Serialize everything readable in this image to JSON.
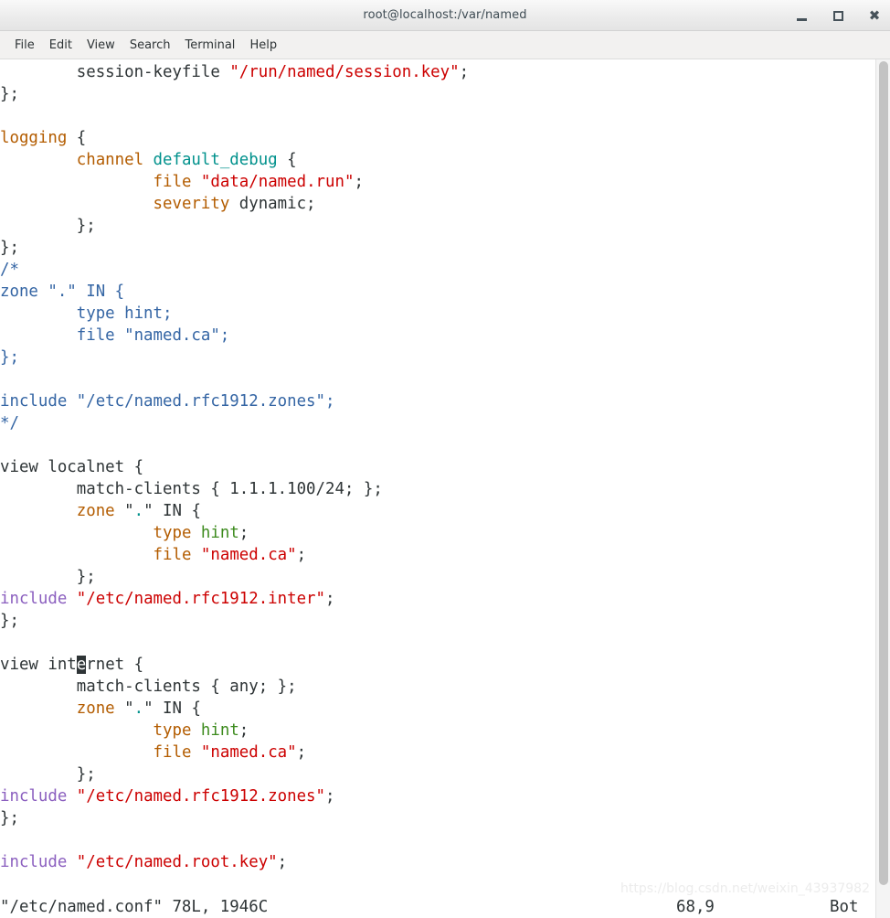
{
  "window": {
    "title": "root@localhost:/var/named",
    "buttons": {
      "minimize": "minimize-button",
      "maximize": "maximize-button",
      "close": "close-button"
    }
  },
  "menubar": {
    "items": [
      {
        "label": "File"
      },
      {
        "label": "Edit"
      },
      {
        "label": "View"
      },
      {
        "label": "Search"
      },
      {
        "label": "Terminal"
      },
      {
        "label": "Help"
      }
    ]
  },
  "editor": {
    "program": "vim",
    "colors": {
      "plain": "#2e3436",
      "keyword": "#b35c00",
      "identifier": "#00918c",
      "string": "#cc0000",
      "comment": "#3465a4",
      "preproc": "#8b5fbf",
      "type": "#3d8b1e",
      "cursor_bg": "#2e3436",
      "background": "#ffffff"
    },
    "lines": [
      [
        {
          "t": "        ",
          "c": "plain"
        },
        {
          "t": "session-keyfile",
          "c": "plain"
        },
        {
          "t": " ",
          "c": "plain"
        },
        {
          "t": "\"/run/named/session.key\"",
          "c": "string"
        },
        {
          "t": ";",
          "c": "plain"
        }
      ],
      [
        {
          "t": "};",
          "c": "plain"
        }
      ],
      [],
      [
        {
          "t": "logging",
          "c": "keyword"
        },
        {
          "t": " {",
          "c": "plain"
        }
      ],
      [
        {
          "t": "        ",
          "c": "plain"
        },
        {
          "t": "channel",
          "c": "keyword"
        },
        {
          "t": " ",
          "c": "plain"
        },
        {
          "t": "default_debug",
          "c": "identifier"
        },
        {
          "t": " {",
          "c": "plain"
        }
      ],
      [
        {
          "t": "                ",
          "c": "plain"
        },
        {
          "t": "file",
          "c": "keyword"
        },
        {
          "t": " ",
          "c": "plain"
        },
        {
          "t": "\"data/named.run\"",
          "c": "string"
        },
        {
          "t": ";",
          "c": "plain"
        }
      ],
      [
        {
          "t": "                ",
          "c": "plain"
        },
        {
          "t": "severity",
          "c": "keyword"
        },
        {
          "t": " dynamic;",
          "c": "plain"
        }
      ],
      [
        {
          "t": "        };",
          "c": "plain"
        }
      ],
      [
        {
          "t": "};",
          "c": "plain"
        }
      ],
      [
        {
          "t": "/*",
          "c": "comment"
        }
      ],
      [
        {
          "t": "zone \".\" IN {",
          "c": "comment"
        }
      ],
      [
        {
          "t": "        type hint;",
          "c": "comment"
        }
      ],
      [
        {
          "t": "        file \"named.ca\";",
          "c": "comment"
        }
      ],
      [
        {
          "t": "};",
          "c": "comment"
        }
      ],
      [],
      [
        {
          "t": "include \"/etc/named.rfc1912.zones\";",
          "c": "comment"
        }
      ],
      [
        {
          "t": "*/",
          "c": "comment"
        }
      ],
      [],
      [
        {
          "t": "view localnet {",
          "c": "plain"
        }
      ],
      [
        {
          "t": "        match-clients { 1.1.1.100/24; };",
          "c": "plain"
        }
      ],
      [
        {
          "t": "        ",
          "c": "plain"
        },
        {
          "t": "zone",
          "c": "keyword"
        },
        {
          "t": " \"",
          "c": "plain"
        },
        {
          "t": ".",
          "c": "identifier"
        },
        {
          "t": "\" IN {",
          "c": "plain"
        }
      ],
      [
        {
          "t": "                ",
          "c": "plain"
        },
        {
          "t": "type",
          "c": "keyword"
        },
        {
          "t": " ",
          "c": "plain"
        },
        {
          "t": "hint",
          "c": "type"
        },
        {
          "t": ";",
          "c": "plain"
        }
      ],
      [
        {
          "t": "                ",
          "c": "plain"
        },
        {
          "t": "file",
          "c": "keyword"
        },
        {
          "t": " ",
          "c": "plain"
        },
        {
          "t": "\"named.ca\"",
          "c": "string"
        },
        {
          "t": ";",
          "c": "plain"
        }
      ],
      [
        {
          "t": "        };",
          "c": "plain"
        }
      ],
      [
        {
          "t": "include",
          "c": "preproc"
        },
        {
          "t": " ",
          "c": "plain"
        },
        {
          "t": "\"/etc/named.rfc1912.inter\"",
          "c": "string"
        },
        {
          "t": ";",
          "c": "plain"
        }
      ],
      [
        {
          "t": "};",
          "c": "plain"
        }
      ],
      [],
      [
        {
          "t": "view int",
          "c": "plain"
        },
        {
          "t": "e",
          "c": "cursor"
        },
        {
          "t": "rnet {",
          "c": "plain"
        }
      ],
      [
        {
          "t": "        match-clients { any; };",
          "c": "plain"
        }
      ],
      [
        {
          "t": "        ",
          "c": "plain"
        },
        {
          "t": "zone",
          "c": "keyword"
        },
        {
          "t": " \"",
          "c": "plain"
        },
        {
          "t": ".",
          "c": "identifier"
        },
        {
          "t": "\" IN {",
          "c": "plain"
        }
      ],
      [
        {
          "t": "                ",
          "c": "plain"
        },
        {
          "t": "type",
          "c": "keyword"
        },
        {
          "t": " ",
          "c": "plain"
        },
        {
          "t": "hint",
          "c": "type"
        },
        {
          "t": ";",
          "c": "plain"
        }
      ],
      [
        {
          "t": "                ",
          "c": "plain"
        },
        {
          "t": "file",
          "c": "keyword"
        },
        {
          "t": " ",
          "c": "plain"
        },
        {
          "t": "\"named.ca\"",
          "c": "string"
        },
        {
          "t": ";",
          "c": "plain"
        }
      ],
      [
        {
          "t": "        };",
          "c": "plain"
        }
      ],
      [
        {
          "t": "include",
          "c": "preproc"
        },
        {
          "t": " ",
          "c": "plain"
        },
        {
          "t": "\"/etc/named.rfc1912.zones\"",
          "c": "string"
        },
        {
          "t": ";",
          "c": "plain"
        }
      ],
      [
        {
          "t": "};",
          "c": "plain"
        }
      ],
      [],
      [
        {
          "t": "include",
          "c": "preproc"
        },
        {
          "t": " ",
          "c": "plain"
        },
        {
          "t": "\"/etc/named.root.key\"",
          "c": "string"
        },
        {
          "t": ";",
          "c": "plain"
        }
      ],
      []
    ]
  },
  "statusline": {
    "file_info": "\"/etc/named.conf\" 78L, 1946C",
    "cursor_position": "68,9",
    "scroll_position": "Bot"
  },
  "watermark": {
    "text": "https://blog.csdn.net/weixin_43937982"
  }
}
